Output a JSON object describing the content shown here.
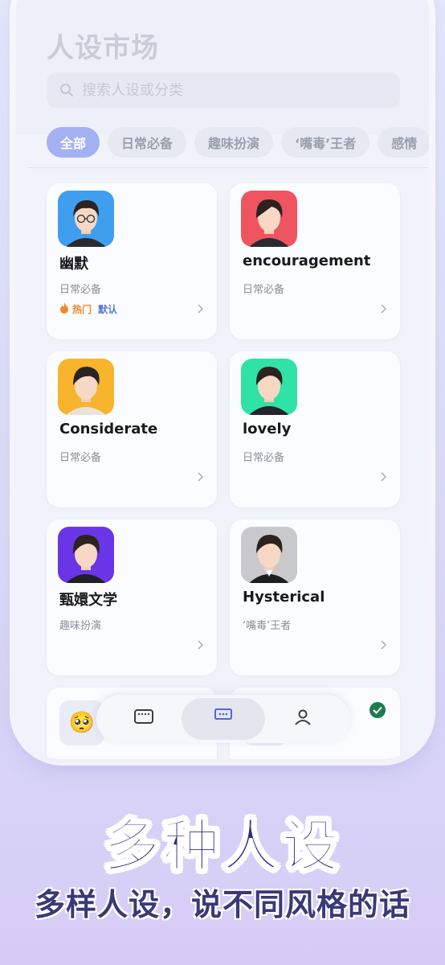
{
  "header": {
    "title": "人设市场"
  },
  "search": {
    "placeholder": "搜索人设或分类"
  },
  "tabs": [
    {
      "label": "全部",
      "active": true
    },
    {
      "label": "日常必备",
      "active": false
    },
    {
      "label": "趣味扮演",
      "active": false
    },
    {
      "label": "‘嘴毒’王者",
      "active": false
    },
    {
      "label": "感情",
      "active": false
    }
  ],
  "cards": [
    {
      "name": "幽默",
      "category": "日常必备",
      "tags": [
        "热门",
        "默认"
      ],
      "avatar_bg": "#3f9fee"
    },
    {
      "name": "encouragement",
      "category": "日常必备",
      "tags": [],
      "avatar_bg": "#ef5560"
    },
    {
      "name": "Considerate",
      "category": "日常必备",
      "tags": [],
      "avatar_bg": "#f7b42c"
    },
    {
      "name": "lovely",
      "category": "日常必备",
      "tags": [],
      "avatar_bg": "#2ee3a5"
    },
    {
      "name": "甄嬛文学",
      "category": "趣味扮演",
      "tags": [],
      "avatar_bg": "#6a35e6"
    },
    {
      "name": "Hysterical",
      "category": "‘嘴毒’王者",
      "tags": [],
      "avatar_bg": "#c9c9cc"
    }
  ],
  "partial_cards": [
    {
      "emoji": "🥺",
      "checked": true
    },
    {
      "emoji": "",
      "checked": true
    }
  ],
  "bottom_nav": {
    "selected_index": 1,
    "icons": [
      "keyboard-icon",
      "chat-bubble-icon",
      "person-icon"
    ]
  },
  "promo": {
    "headline": "多种人设",
    "subline": "多样人设，说不同风格的话"
  },
  "colors": {
    "accent": "#a3b1f2",
    "headline": "#2b2a86",
    "hot": "#e98a2c",
    "default_tag": "#5677d6",
    "check": "#1f7a4d"
  }
}
